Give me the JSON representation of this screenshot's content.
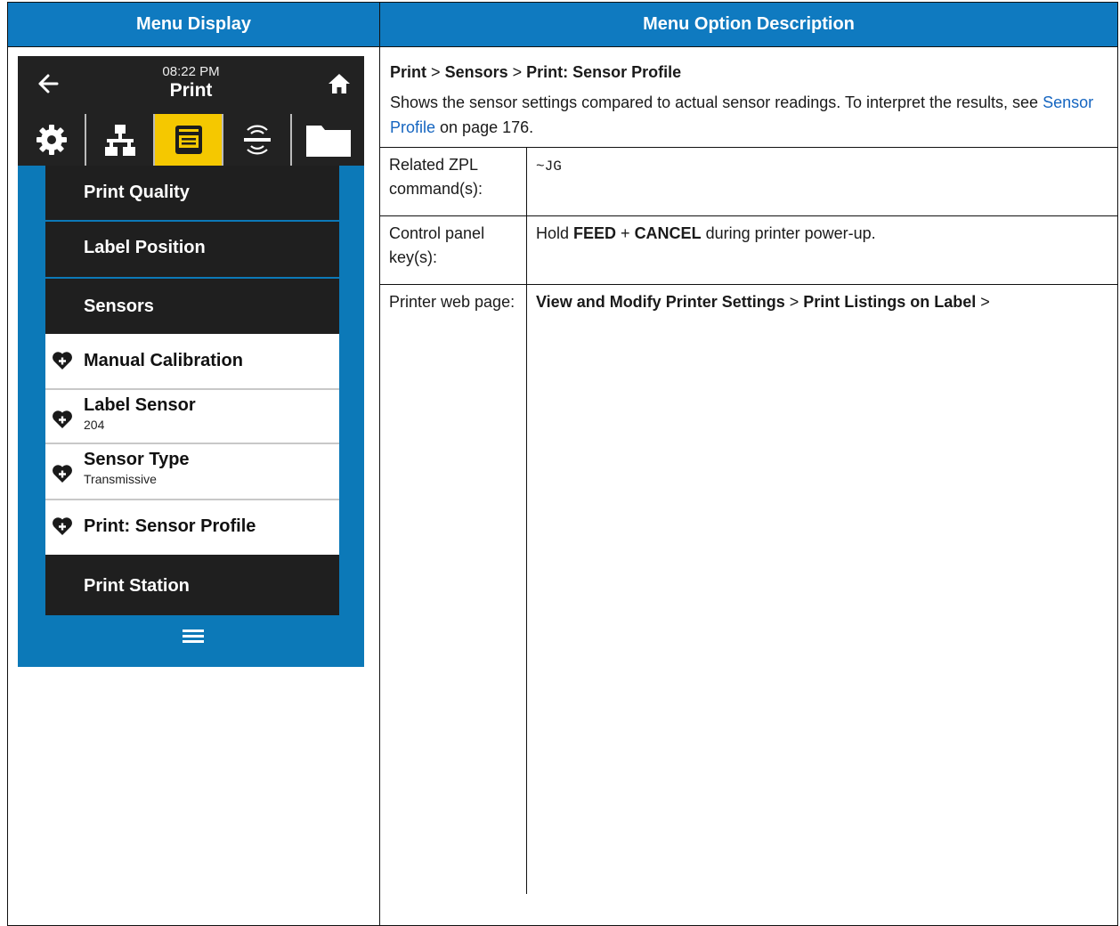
{
  "table": {
    "header_left": "Menu Display",
    "header_right": "Menu Option Description"
  },
  "screen": {
    "time": "08:22 PM",
    "title": "Print",
    "tabs": [
      "settings",
      "network",
      "print",
      "rfid",
      "storage"
    ],
    "active_tab": "print",
    "items": [
      {
        "label": "Print Quality",
        "style": "dark"
      },
      {
        "label": "Label Position",
        "style": "dark"
      },
      {
        "label": "Sensors",
        "style": "dark"
      },
      {
        "label": "Manual Calibration",
        "style": "light",
        "favorite": true
      },
      {
        "label": "Label Sensor",
        "value": "204",
        "style": "light",
        "favorite": true
      },
      {
        "label": "Sensor Type",
        "value": "Transmissive",
        "style": "light",
        "favorite": true
      },
      {
        "label": "Print: Sensor Profile",
        "style": "light",
        "favorite": true
      },
      {
        "label": "Print Station",
        "style": "dark"
      }
    ],
    "colors": {
      "accent": "#f5c800",
      "background": "#0c79b8",
      "dark_item": "#1f1f1f"
    }
  },
  "description": {
    "crumb1": "Print",
    "crumb2": "Sensors",
    "crumb3": "Print: Sensor Profile",
    "sep": ">",
    "text_before": "Shows the sensor settings compared to actual sensor readings. To interpret the results, see ",
    "link_text": "Sensor Profile",
    "text_after": " on page 176.",
    "rows": [
      {
        "label": "Related ZPL command(s):",
        "value": "~JG"
      },
      {
        "label": "Control panel key(s):",
        "pre": "Hold ",
        "key1": "FEED",
        "mid": " + ",
        "key2": "CANCEL",
        "post": " during printer power-up."
      },
      {
        "label": "Printer web page:",
        "bold1": "View and Modify Printer Settings",
        "sep": " > ",
        "bold2": "Print Listings on Label",
        "post": " >"
      }
    ]
  }
}
